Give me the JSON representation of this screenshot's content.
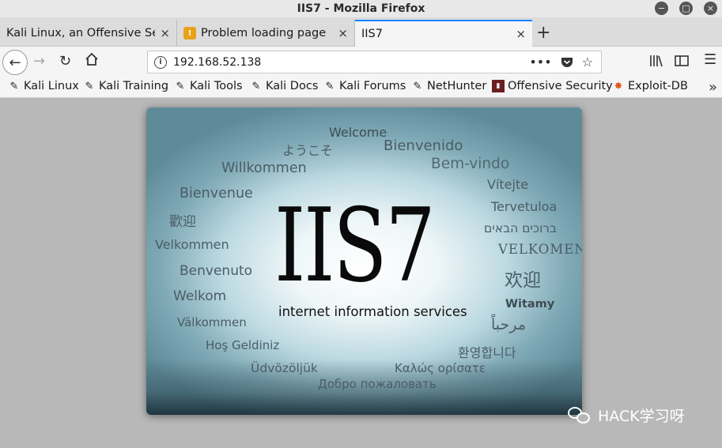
{
  "window": {
    "title": "IIS7 - Mozilla Firefox"
  },
  "tabs": [
    {
      "label": "Kali Linux, an Offensive Secu",
      "close": "×"
    },
    {
      "label": "Problem loading page",
      "close": "×",
      "icon": "warning-icon"
    },
    {
      "label": "IIS7",
      "close": "×",
      "active": true
    }
  ],
  "newtab_label": "+",
  "nav": {
    "url": "192.168.52.138",
    "page_actions": "•••"
  },
  "bookmarks": [
    {
      "label": "Kali Linux",
      "icon": "kali-dragon-icon"
    },
    {
      "label": "Kali Training",
      "icon": "kali-dragon-icon"
    },
    {
      "label": "Kali Tools",
      "icon": "kali-dragon-icon"
    },
    {
      "label": "Kali Docs",
      "icon": "kali-dragon-icon"
    },
    {
      "label": "Kali Forums",
      "icon": "kali-dragon-icon"
    },
    {
      "label": "NetHunter",
      "icon": "kali-dragon-icon"
    },
    {
      "label": "Offensive Security",
      "icon": "offsec-icon"
    },
    {
      "label": "Exploit-DB",
      "icon": "exploitdb-icon"
    }
  ],
  "page": {
    "title": "IIS7",
    "subtitle": "internet information services",
    "greetings": {
      "welcome": "Welcome",
      "japanese": "ようこそ",
      "spanish": "Bienvenido",
      "german": "Willkommen",
      "portuguese": "Bem-vindo",
      "french": "Bienvenue",
      "czech": "Vítejte",
      "trad_chinese": "歡迎",
      "estonian": "Tervetuloa",
      "hebrew": "ברוכים הבאים",
      "norwegian": "Velkommen",
      "danish": "VELKOMEN",
      "italian": "Benvenuto",
      "simp_chinese": "欢迎",
      "dutch": "Welkom",
      "polish": "Witamy",
      "swedish": "Välkommen",
      "arabic": "مرحباً",
      "turkish": "Hoş Geldiniz",
      "korean": "환영합니다",
      "hungarian": "Üdvözöljük",
      "greek": "Καλώς ορίσατε",
      "russian": "Добро пожаловать"
    }
  },
  "watermark": {
    "text": "HACK学习呀"
  }
}
